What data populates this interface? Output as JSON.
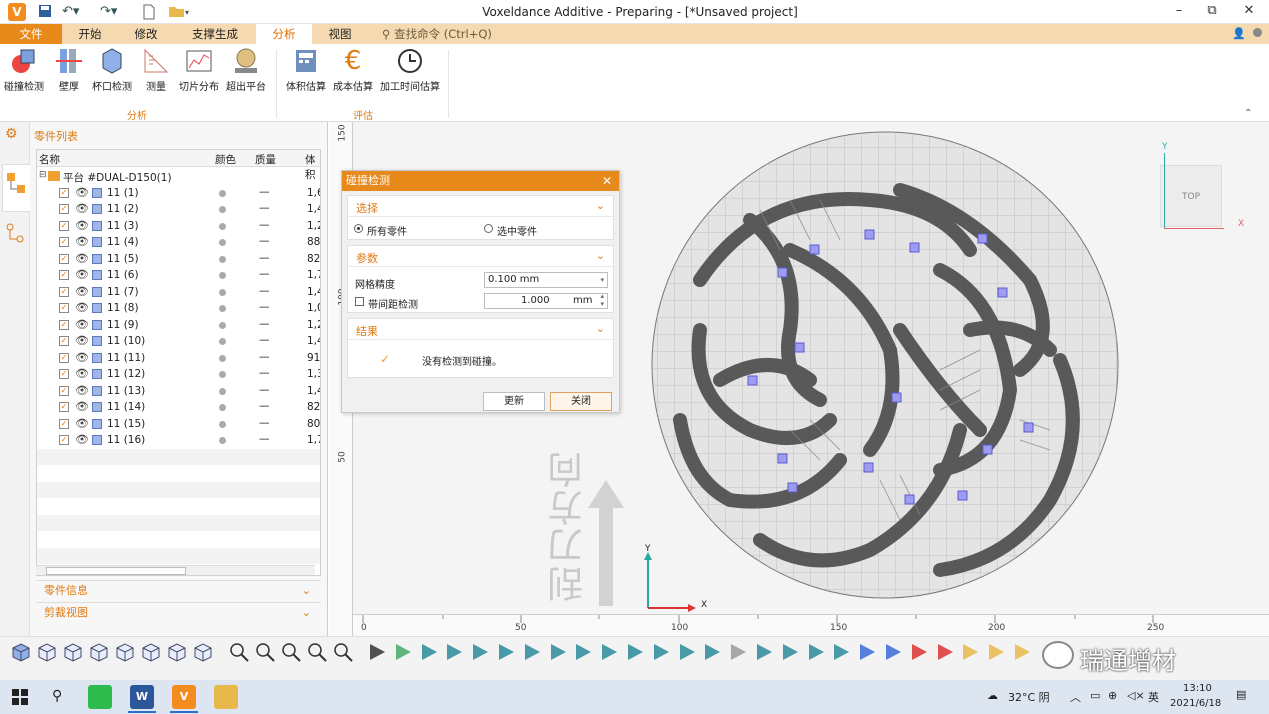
{
  "window": {
    "title": "Voxeldance Additive - Preparing - [*Unsaved project]",
    "min": "–",
    "max": "⧉",
    "close": "✕"
  },
  "menu": {
    "items": [
      "文件",
      "开始",
      "修改",
      "支撑生成",
      "分析",
      "视图"
    ],
    "search": "查找命令 (Ctrl+Q)"
  },
  "ribbon": {
    "analysis_buttons": [
      "碰撞检测",
      "壁厚",
      "杯口检测",
      "测量",
      "切片分布",
      "超出平台"
    ],
    "analysis_group": "分析",
    "estimate_buttons": [
      "体积估算",
      "成本估算",
      "加工时间估算"
    ],
    "estimate_group": "评估"
  },
  "panel": {
    "header": "零件列表",
    "columns": [
      "名称",
      "颜色",
      "质量",
      "体积"
    ],
    "platform": "平台 #DUAL-D150(1)",
    "parts": [
      {
        "name": "11 (1)",
        "mass": "—",
        "vol": "1,6"
      },
      {
        "name": "11 (2)",
        "mass": "—",
        "vol": "1,4"
      },
      {
        "name": "11 (3)",
        "mass": "—",
        "vol": "1,2"
      },
      {
        "name": "11 (4)",
        "mass": "—",
        "vol": "888"
      },
      {
        "name": "11 (5)",
        "mass": "—",
        "vol": "824"
      },
      {
        "name": "11 (6)",
        "mass": "—",
        "vol": "1,7"
      },
      {
        "name": "11 (7)",
        "mass": "—",
        "vol": "1,4"
      },
      {
        "name": "11 (8)",
        "mass": "—",
        "vol": "1,0"
      },
      {
        "name": "11 (9)",
        "mass": "—",
        "vol": "1,2"
      },
      {
        "name": "11 (10)",
        "mass": "—",
        "vol": "1,4"
      },
      {
        "name": "11 (11)",
        "mass": "—",
        "vol": "913"
      },
      {
        "name": "11 (12)",
        "mass": "—",
        "vol": "1,3"
      },
      {
        "name": "11 (13)",
        "mass": "—",
        "vol": "1,4"
      },
      {
        "name": "11 (14)",
        "mass": "—",
        "vol": "822"
      },
      {
        "name": "11 (15)",
        "mass": "—",
        "vol": "802"
      },
      {
        "name": "11 (16)",
        "mass": "—",
        "vol": "1,7"
      }
    ],
    "info_section": "零件信息",
    "clip_section": "剪裁视图"
  },
  "dialog": {
    "title": "碰撞检测",
    "close": "✕",
    "select_header": "选择",
    "opt_all": "所有零件",
    "opt_selected": "选中零件",
    "params_header": "参数",
    "grid_label": "网格精度",
    "grid_value": "0.100 mm",
    "gap_label": "带间距检测",
    "gap_value": "1.000",
    "gap_unit": "mm",
    "result_header": "结果",
    "result_text": "没有检测到碰撞。",
    "btn_update": "更新",
    "btn_close": "关闭"
  },
  "viewport": {
    "vruler": [
      "150",
      "100",
      "50"
    ],
    "hruler": [
      "0",
      "50",
      "100",
      "150",
      "200",
      "250"
    ],
    "axis_x": "X",
    "axis_y": "Y",
    "cube_label": "TOP",
    "cube_x": "X",
    "cube_y": "Y",
    "direction_text": "刮刀方向",
    "watermark": "瑞通增材"
  },
  "taskbar": {
    "weather": "32°C 阴",
    "lang": "英",
    "time": "13:10",
    "date": "2021/6/18"
  }
}
